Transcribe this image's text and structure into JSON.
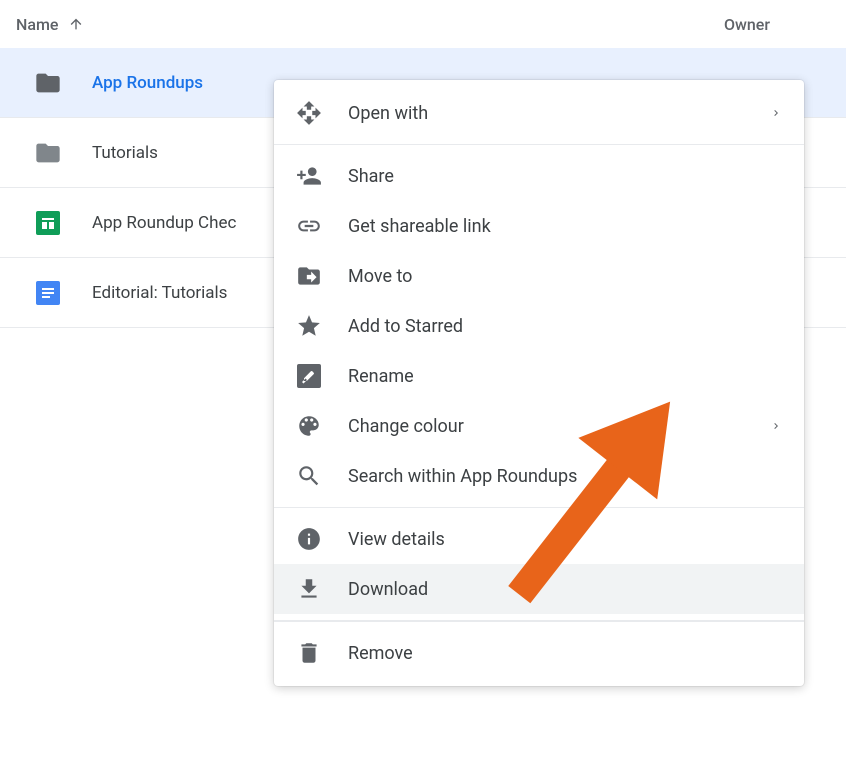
{
  "header": {
    "name_label": "Name",
    "owner_label": "Owner"
  },
  "files": [
    {
      "name": "App Roundups",
      "type": "folder",
      "selected": true
    },
    {
      "name": "Tutorials",
      "type": "folder",
      "selected": false
    },
    {
      "name": "App Roundup Chec",
      "type": "sheets",
      "selected": false
    },
    {
      "name": "Editorial: Tutorials",
      "type": "docs",
      "selected": false
    }
  ],
  "context_menu": {
    "open_with": "Open with",
    "share": "Share",
    "get_link": "Get shareable link",
    "move_to": "Move to",
    "add_starred": "Add to Starred",
    "rename": "Rename",
    "change_colour": "Change colour",
    "search_within": "Search within App Roundups",
    "view_details": "View details",
    "download": "Download",
    "remove": "Remove"
  }
}
